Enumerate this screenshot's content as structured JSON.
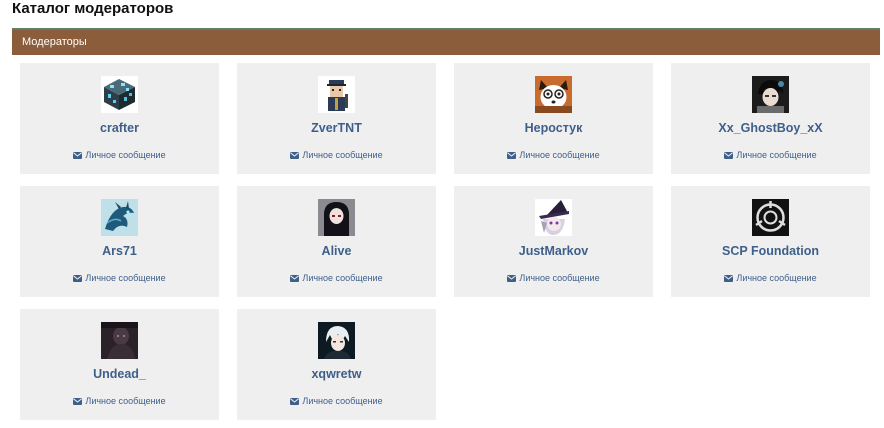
{
  "page": {
    "title": "Каталог модераторов"
  },
  "section": {
    "title": "Модераторы"
  },
  "moderators": [
    {
      "name": "crafter",
      "pm_label": "Личное сообщение",
      "avatar_icon": "minecraft-ore-block-icon"
    },
    {
      "name": "ZverTNT",
      "pm_label": "Личное сообщение",
      "avatar_icon": "police-officer-icon"
    },
    {
      "name": "Неростук",
      "pm_label": "Личное сообщение",
      "avatar_icon": "fox-character-icon"
    },
    {
      "name": "Xx_GhostBoy_xX",
      "pm_label": "Личное сообщение",
      "avatar_icon": "anime-boy-icon"
    },
    {
      "name": "Ars71",
      "pm_label": "Личное сообщение",
      "avatar_icon": "dragon-icon"
    },
    {
      "name": "Alive",
      "pm_label": "Личное сообщение",
      "avatar_icon": "dark-haired-girl-icon"
    },
    {
      "name": "JustMarkov",
      "pm_label": "Личное сообщение",
      "avatar_icon": "witch-hat-girl-icon"
    },
    {
      "name": "SCP Foundation",
      "pm_label": "Личное сообщение",
      "avatar_icon": "scp-logo-icon"
    },
    {
      "name": "Undead_",
      "pm_label": "Личное сообщение",
      "avatar_icon": "dark-figure-icon"
    },
    {
      "name": "xqwretw",
      "pm_label": "Личное сообщение",
      "avatar_icon": "white-haired-character-icon"
    }
  ],
  "colors": {
    "header_bg": "#8b5d3b",
    "header_border": "#5f7f6a",
    "card_bg": "#efefef",
    "link": "#3e5f8a"
  }
}
